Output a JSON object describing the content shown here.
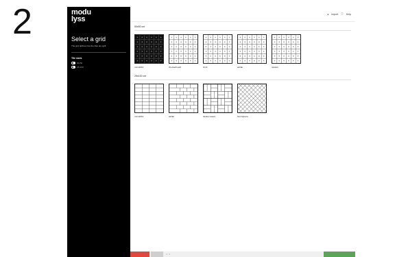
{
  "step_number": "2",
  "sidebar": {
    "logo_line1": "modu",
    "logo_line2": "lyss",
    "title": "Select a grid",
    "subtitle": "The grid defines how the tiles are split.",
    "section_title": "Tile sizes",
    "toggles": [
      {
        "label": "50x50",
        "on": true
      },
      {
        "label": "25x100",
        "on": true
      }
    ]
  },
  "topbar": {
    "import_label": "Import",
    "help_label": "Help"
  },
  "sections": [
    {
      "label": "50x50 cm",
      "tiles": [
        {
          "label": "monolithic",
          "pattern": "filled"
        },
        {
          "label": "checkerboard",
          "pattern": "grid"
        },
        {
          "label": "brick",
          "pattern": "grid"
        },
        {
          "label": "ashlar",
          "pattern": "grid"
        },
        {
          "label": "random",
          "pattern": "grid"
        }
      ]
    },
    {
      "label": "25x100 cm",
      "tiles": [
        {
          "label": "monolithic",
          "pattern": "planks"
        },
        {
          "label": "ashlar",
          "pattern": "planks-offset"
        },
        {
          "label": "basket weave",
          "pattern": "basket"
        },
        {
          "label": "herringbone",
          "pattern": "herringbone"
        }
      ]
    }
  ],
  "bottombar": {
    "left_label": "",
    "middle_label": "",
    "status_text": "1 / 4",
    "right_label": ""
  },
  "colors": {
    "sidebar_bg": "#000000",
    "accent_red": "#e2463c",
    "accent_green": "#5aa654"
  }
}
